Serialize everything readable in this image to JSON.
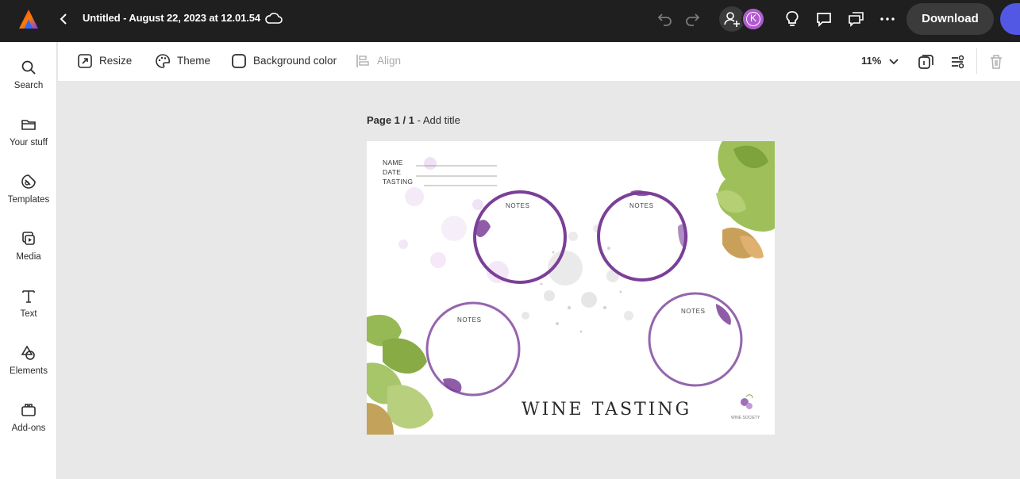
{
  "topbar": {
    "doc_title": "Untitled - August 22, 2023 at 12.01.54",
    "avatar_initial": "K",
    "download_label": "Download"
  },
  "rail": {
    "items": [
      {
        "label": "Search",
        "icon": "search-icon"
      },
      {
        "label": "Your stuff",
        "icon": "folder-icon"
      },
      {
        "label": "Templates",
        "icon": "templates-icon"
      },
      {
        "label": "Media",
        "icon": "media-icon"
      },
      {
        "label": "Text",
        "icon": "text-icon"
      },
      {
        "label": "Elements",
        "icon": "elements-icon"
      },
      {
        "label": "Add-ons",
        "icon": "addons-icon"
      }
    ]
  },
  "props": {
    "resize": "Resize",
    "theme": "Theme",
    "background_color": "Background color",
    "align": "Align",
    "zoom": "11%"
  },
  "canvas": {
    "page_number": "Page 1 / 1",
    "page_title_placeholder": " - Add title",
    "artwork": {
      "fields": [
        "NAME",
        "DATE",
        "TASTING"
      ],
      "note_label": "NOTES",
      "title": "WINE TASTING",
      "brand": "WINE SOCIETY"
    }
  },
  "colors": {
    "topbar_bg": "#1f1f1f",
    "accent": "#5258e4",
    "avatar": "#b05bd0",
    "wine": "#7b3f98"
  }
}
